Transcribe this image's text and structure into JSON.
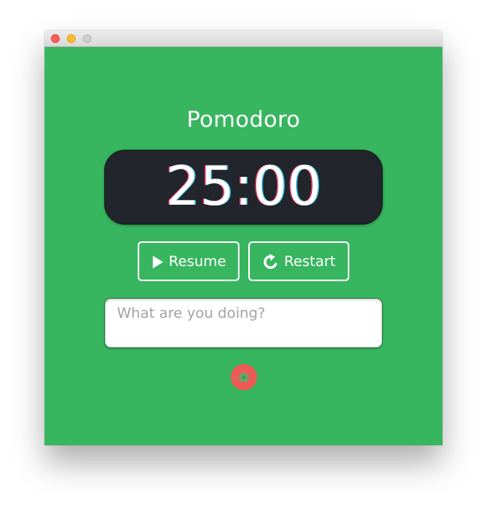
{
  "window": {
    "traffic_lights": [
      "close",
      "minimize",
      "maximize"
    ]
  },
  "app": {
    "title": "Pomodoro",
    "timer": "25:00",
    "buttons": {
      "resume": {
        "label": "Resume",
        "icon": "play-icon"
      },
      "restart": {
        "label": "Restart",
        "icon": "restart-icon"
      }
    },
    "task_input": {
      "value": "",
      "placeholder": "What are you doing?"
    },
    "tomato_icon": "tomato-icon"
  },
  "colors": {
    "background": "#38b55f",
    "timer_background": "#22252b",
    "text": "#ffffff",
    "tomato": "#ee5b56",
    "tomato_leaf": "#52b26b"
  }
}
